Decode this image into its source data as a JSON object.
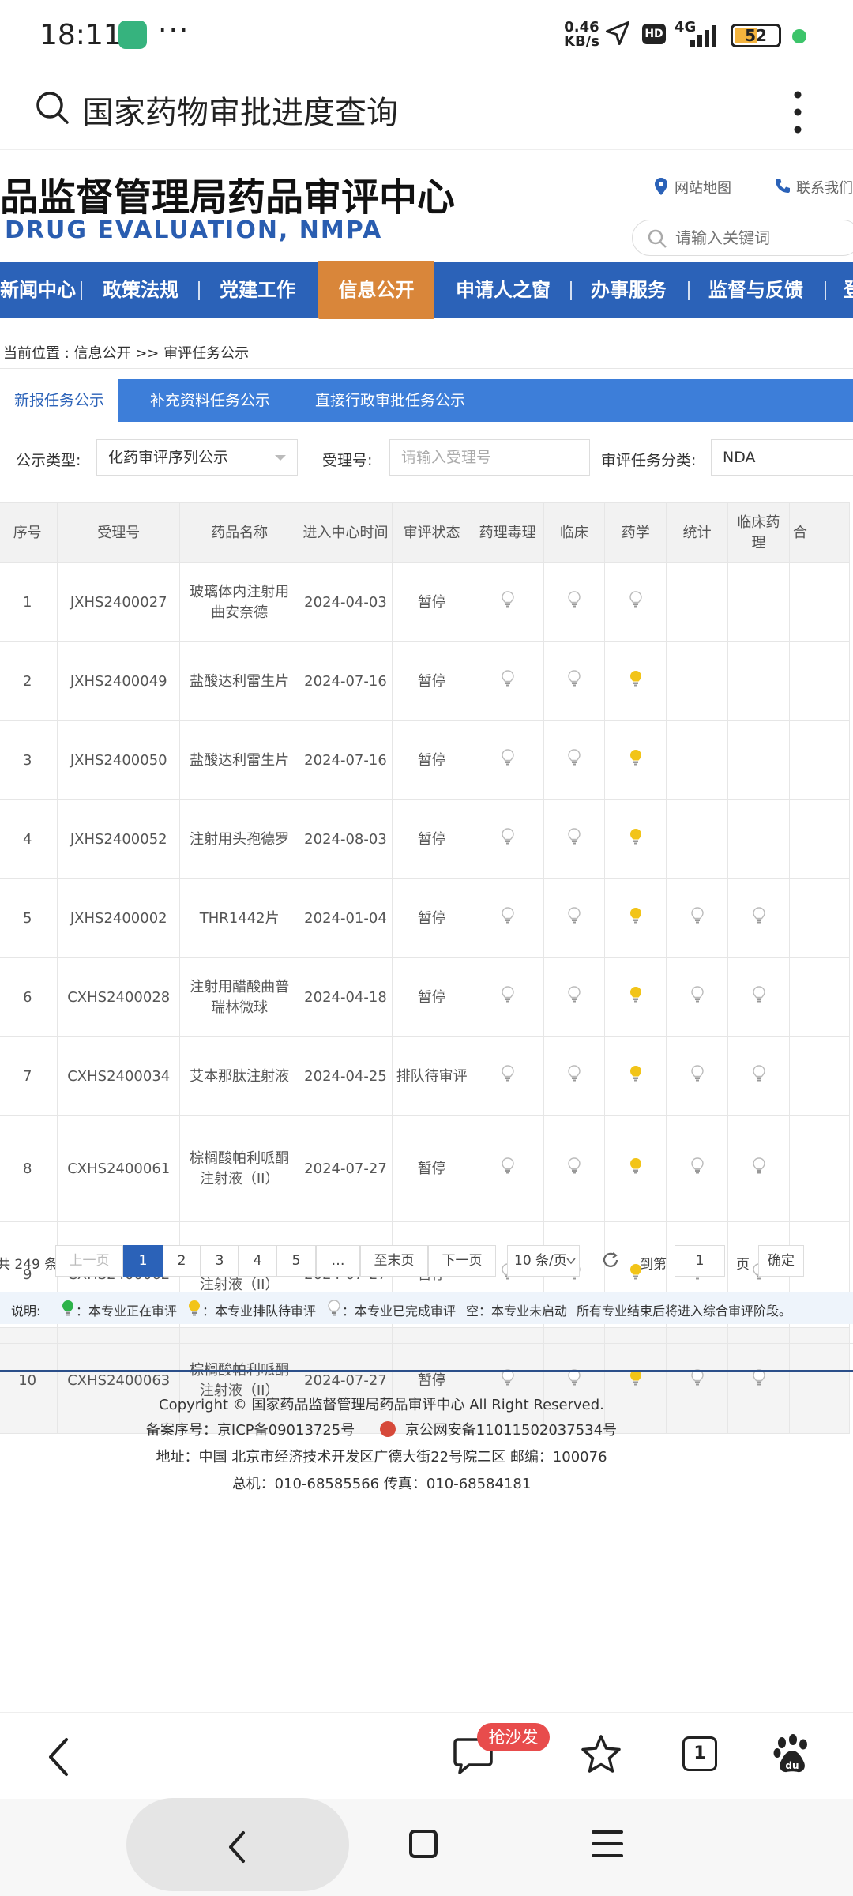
{
  "status_bar": {
    "time": "18:11",
    "more": "···",
    "net_speed_value": "0.46",
    "net_speed_unit": "KB/s",
    "hd": "HD",
    "network": "4G",
    "battery": "52"
  },
  "header": {
    "search_title": "国家药物审批进度查询"
  },
  "site": {
    "title": "品监督管理局药品审评中心",
    "subtitle": "DRUG EVALUATION, NMPA",
    "links": {
      "sitemap": "网站地图",
      "contact": "联系我们"
    },
    "search_placeholder": "请输入关键词"
  },
  "nav": [
    "新闻中心",
    "政策法规",
    "党建工作",
    "信息公开",
    "申请人之窗",
    "办事服务",
    "监督与反馈",
    "登"
  ],
  "nav_active": "信息公开",
  "breadcrumb": "当前位置 : 信息公开 >> 审评任务公示",
  "tabs": [
    "新报任务公示",
    "补充资料任务公示",
    "直接行政审批任务公示"
  ],
  "filters": {
    "type_label": "公示类型:",
    "type_value": "化药审评序列公示",
    "accept_label": "受理号:",
    "accept_placeholder": "请输入受理号",
    "category_label": "审评任务分类:",
    "category_value": "NDA"
  },
  "table": {
    "columns": [
      "序号",
      "受理号",
      "药品名称",
      "进入中心时间",
      "审评状态",
      "药理毒理",
      "临床",
      "药学",
      "统计",
      "临床药理",
      "合"
    ],
    "rows": [
      {
        "no": "1",
        "accept": "JXHS2400027",
        "name": "玻璃体内注射用曲安奈德",
        "date": "2024-04-03",
        "status": "暂停",
        "bulbs": [
          "done",
          "done",
          "done",
          "",
          "",
          ""
        ]
      },
      {
        "no": "2",
        "accept": "JXHS2400049",
        "name": "盐酸达利雷生片",
        "date": "2024-07-16",
        "status": "暂停",
        "bulbs": [
          "done",
          "done",
          "queue",
          "",
          "",
          ""
        ]
      },
      {
        "no": "3",
        "accept": "JXHS2400050",
        "name": "盐酸达利雷生片",
        "date": "2024-07-16",
        "status": "暂停",
        "bulbs": [
          "done",
          "done",
          "queue",
          "",
          "",
          ""
        ]
      },
      {
        "no": "4",
        "accept": "JXHS2400052",
        "name": "注射用头孢德罗",
        "date": "2024-08-03",
        "status": "暂停",
        "bulbs": [
          "done",
          "done",
          "queue",
          "",
          "",
          ""
        ]
      },
      {
        "no": "5",
        "accept": "JXHS2400002",
        "name": "THR1442片",
        "date": "2024-01-04",
        "status": "暂停",
        "bulbs": [
          "done",
          "done",
          "queue",
          "done",
          "done",
          ""
        ]
      },
      {
        "no": "6",
        "accept": "CXHS2400028",
        "name": "注射用醋酸曲普瑞林微球",
        "date": "2024-04-18",
        "status": "暂停",
        "bulbs": [
          "done",
          "done",
          "queue",
          "done",
          "done",
          ""
        ]
      },
      {
        "no": "7",
        "accept": "CXHS2400034",
        "name": "艾本那肽注射液",
        "date": "2024-04-25",
        "status": "排队待审评",
        "bulbs": [
          "done",
          "done",
          "queue",
          "done",
          "done",
          ""
        ]
      },
      {
        "no": "8",
        "accept": "CXHS2400061",
        "name": "棕榈酸帕利哌酮注射液（II）",
        "date": "2024-07-27",
        "status": "暂停",
        "bulbs": [
          "done",
          "done",
          "queue",
          "done",
          "done",
          ""
        ]
      },
      {
        "no": "9",
        "accept": "CXHS2400062",
        "name": "棕榈酸帕利哌酮注射液（II）",
        "date": "2024-07-27",
        "status": "暂停",
        "bulbs": [
          "done",
          "done",
          "queue",
          "done",
          "done",
          ""
        ]
      },
      {
        "no": "10",
        "accept": "CXHS2400063",
        "name": "棕榈酸帕利哌酮注射液（II）",
        "date": "2024-07-27",
        "status": "暂停",
        "bulbs": [
          "done",
          "done",
          "queue",
          "done",
          "done",
          ""
        ]
      }
    ]
  },
  "pagination": {
    "total": "共 249 条",
    "prev": "上一页",
    "pages": [
      "1",
      "2",
      "3",
      "4",
      "5",
      "…"
    ],
    "last": "至末页",
    "next": "下一页",
    "per_page": "10 条/页",
    "goto_label": "到第",
    "goto_value": "1",
    "page_unit": "页",
    "confirm": "确定"
  },
  "legend": {
    "title": "说明:",
    "reviewing": "：本专业正在审评",
    "queued": "：本专业排队待审评",
    "done": "：本专业已完成审评",
    "not_started": "空：本专业未启动",
    "note": "所有专业结束后将进入综合审评阶段。"
  },
  "footer": {
    "copyright": "Copyright © 国家药品监督管理局药品审评中心  All Right Reserved.",
    "icp": "备案序号：京ICP备09013725号",
    "police": "京公网安备11011502037534号",
    "address": "地址：中国 北京市经济技术开发区广德大街22号院二区      邮编：100076",
    "phone": "总机：010-68585566      传真：010-68584181"
  },
  "browser": {
    "badge": "抢沙发",
    "tabs_count": "1"
  },
  "colors": {
    "brand_blue": "#2b62b8",
    "nav_active": "#d9863a",
    "tab_blue": "#3d7ed9",
    "bulb_green": "#2db34a",
    "bulb_yellow": "#f2c418",
    "bulb_gray": "#c8c8c8"
  }
}
